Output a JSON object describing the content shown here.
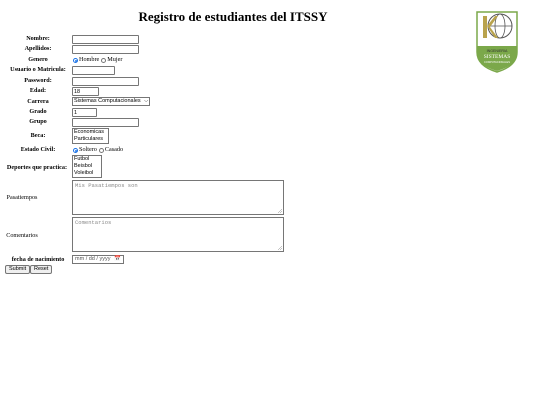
{
  "page": {
    "title": "Registro de estudiantes del ITSSY"
  },
  "logo": {
    "line1": "INGENIERIA",
    "line2": "SISTEMAS",
    "line3": "COMPUTACIONALES"
  },
  "form": {
    "nombre_label": "Nombre:",
    "apellidos_label": "Apellidos:",
    "genero_label": "Genero",
    "genero_options": [
      "Hombre",
      "Mujer"
    ],
    "genero_selected": "Hombre",
    "usuario_label": "Usuario o Matricula:",
    "password_label": "Password:",
    "edad_label": "Edad:",
    "edad_value": "18",
    "carrera_label": "Carrera",
    "carrera_value": "Sistemas Computacionales",
    "grado_label": "Grado",
    "grado_value": "1",
    "grupo_label": "Grupo",
    "beca_label": "Beca:",
    "beca_options": [
      "Economicas",
      "Particulares"
    ],
    "estado_label": "Estado Civil:",
    "estado_options": [
      "Soltero",
      "Casado"
    ],
    "estado_selected": "Soltero",
    "deportes_label": "Deportes que practica:",
    "deportes_options": [
      "Futbol",
      "Beisbol",
      "Voleibol"
    ],
    "pasatiempos_label": "Pasatiempos",
    "pasatiempos_placeholder": "Mis Pasatiempos son",
    "comentarios_label": "Comentarios",
    "comentarios_placeholder": "Comentarios",
    "fecha_label": "fecha de nacimiento",
    "fecha_placeholder": "mm / dd / yyyy",
    "submit_label": "Submit",
    "reset_label": "Reset"
  },
  "colors": {
    "accent": "#1a73e8",
    "border": "#767676",
    "logo_green": "#7ba84a",
    "logo_gold": "#b9a34d"
  }
}
